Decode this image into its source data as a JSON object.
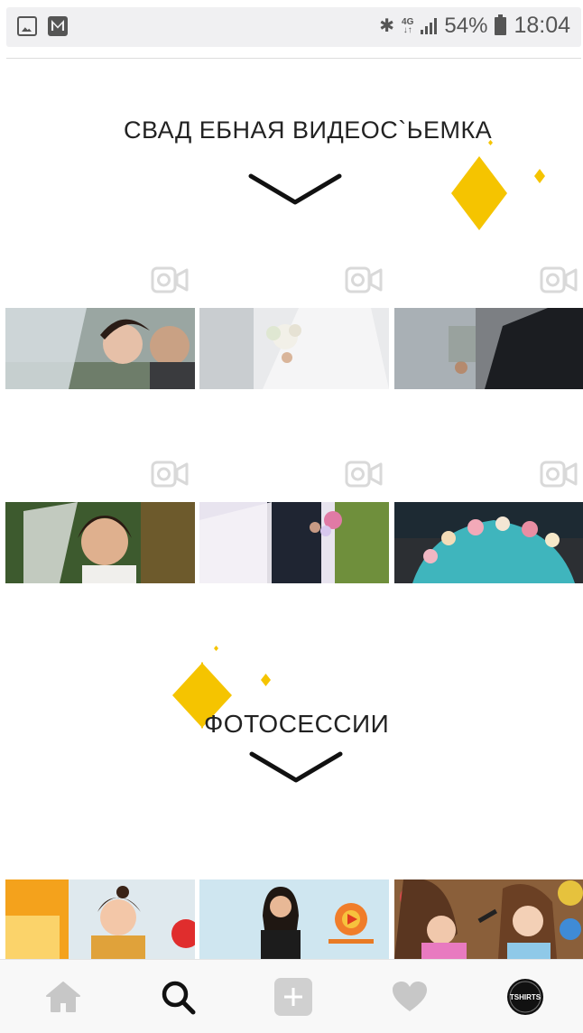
{
  "status_bar": {
    "network": "4G",
    "battery_percent": "54%",
    "time": "18:04",
    "left_icons": [
      "gallery-icon",
      "gmail-icon"
    ],
    "right_icons": [
      "bluetooth-icon",
      "signal-icon",
      "battery-icon"
    ]
  },
  "sections": [
    {
      "title": "СВАД ЕБНАЯ ВИДЕОС`ЬЕМКА",
      "accent": "#f5c400"
    },
    {
      "title": "ФОТОСЕССИИ",
      "accent": "#f5c400"
    }
  ],
  "grid": {
    "video_badge": "video-camera-icon",
    "video_rows": [
      [
        "bride-closeup",
        "bride-bouquet",
        "groom-suit"
      ],
      [
        "bride-portrait",
        "couple-holding-hands",
        "flower-arch"
      ]
    ],
    "photo_row": [
      "girl-at-table",
      "girl-with-logo",
      "girls-braids"
    ]
  },
  "bottom_nav": {
    "items": [
      "home-icon",
      "search-icon",
      "add-icon",
      "heart-icon",
      "profile-avatar"
    ],
    "active": "search-icon",
    "avatar_text": "TSHIRTS"
  }
}
